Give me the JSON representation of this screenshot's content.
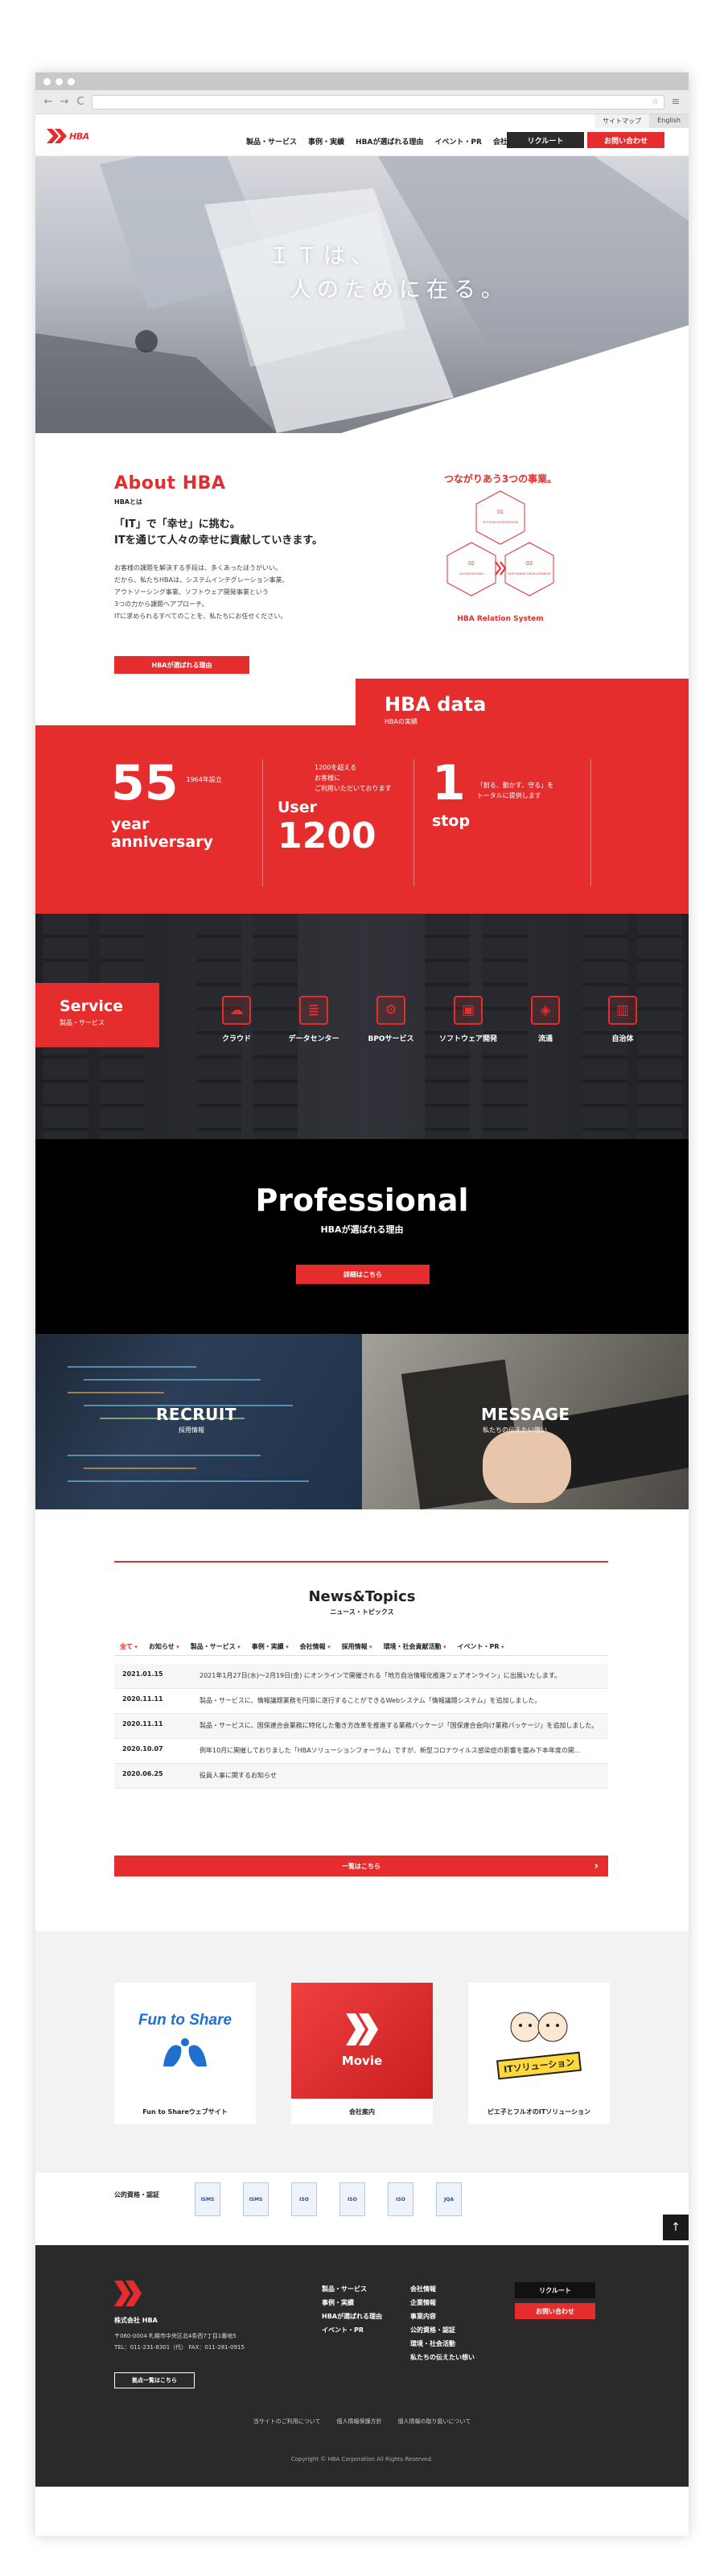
{
  "browser": {
    "nav_back": "←",
    "nav_forward": "→",
    "nav_reload": "C",
    "star": "☆",
    "menu": "≡"
  },
  "header": {
    "utility": [
      "サイトマップ",
      "English"
    ],
    "logo_text": "HBA",
    "nav": [
      "製品・サービス",
      "事例・実績",
      "HBAが選ばれる理由",
      "イベント・PR",
      "会社情報"
    ],
    "recruit_label": "リクルート",
    "contact_label": "お問い合わせ"
  },
  "hero": {
    "line1": "ＩＴは、",
    "line2": "人のために在る。"
  },
  "about": {
    "title": "About HBA",
    "subtitle": "HBAとは",
    "lead1": "「IT」で「幸せ」に挑む。",
    "lead2": "ITを通じて人々の幸せに貢献していきます。",
    "body": [
      "お客様の課題を解決する手段は、多くあったほうがいい。",
      "だから、私たちHBAは、システムインテグレーション事業、",
      "アウトソーシング事業、ソフトウェア開発事業という",
      "3つの力から課題へアプローチ。",
      "ITに求められるすべてのことを、私たちにお任せください。"
    ],
    "button_label": "HBAが選ばれる理由",
    "relation_title": "つながりあう3つの事業。",
    "nodes": [
      {
        "num": "01",
        "label": "SYSTEM INTEGRATION"
      },
      {
        "num": "02",
        "label": "OUTSOURCING"
      },
      {
        "num": "03",
        "label": "SOFTWARE DEVELOPMENT"
      }
    ],
    "relation_label": "HBA Relation System"
  },
  "data_section": {
    "title": "HBA data",
    "subtitle": "HBAの実績",
    "stat1": {
      "number": "55",
      "note": "1964年設立",
      "unit1": "year",
      "unit2": "anniversary"
    },
    "stat2": {
      "note1": "1200を超える",
      "note2": "お客様に",
      "note3": "ご利用いただいております",
      "unit": "User",
      "number": "1200"
    },
    "stat3": {
      "number": "1",
      "note1": "「創る、動かす、守る」を",
      "note2": "トータルに提供します",
      "unit": "stop"
    }
  },
  "service": {
    "title": "Service",
    "subtitle": "製品・サービス",
    "items": [
      {
        "label": "クラウド",
        "icon": "cloud-icon",
        "glyph": "☁"
      },
      {
        "label": "データセンター",
        "icon": "database-icon",
        "glyph": "≣"
      },
      {
        "label": "BPOサービス",
        "icon": "bpo-icon",
        "glyph": "⚙"
      },
      {
        "label": "ソフトウェア開発",
        "icon": "software-icon",
        "glyph": "▣"
      },
      {
        "label": "流通",
        "icon": "box-icon",
        "glyph": "◈"
      },
      {
        "label": "自治体",
        "icon": "building-icon",
        "glyph": "▥"
      }
    ]
  },
  "professional": {
    "title": "Professional",
    "subtitle": "HBAが選ばれる理由",
    "button_label": "詳細はこちら"
  },
  "recruit": {
    "title": "RECRUIT",
    "subtitle": "採用情報"
  },
  "message": {
    "title": "MESSAGE",
    "subtitle": "私たちの伝えたい想い"
  },
  "news": {
    "title": "News&Topics",
    "subtitle": "ニュース・トピックス",
    "tabs": [
      "全て",
      "お知らせ",
      "製品・サービス",
      "事例・実績",
      "会社情報",
      "採用情報",
      "環境・社会貢献活動",
      "イベント・PR"
    ],
    "items": [
      {
        "date": "2021.01.15",
        "text": "2021年1月27日(水)〜2月19日(金) にオンラインで開催される「地方自治情報化推進フェアオンライン」に出展いたします。"
      },
      {
        "date": "2020.11.11",
        "text": "製品・サービスに、情報議題業務を円滑に遂行することができるWebシステム「情報議題システム」を追加しました。"
      },
      {
        "date": "2020.11.11",
        "text": "製品・サービスに、国保連合会業務に特化した働き方改革を推進する業務パッケージ「国保連合会向け業務パッケージ」を追加しました。"
      },
      {
        "date": "2020.10.07",
        "text": "例年10月に開催しておりました「HBAソリューションフォーラム」ですが、新型コロナウイルス感染症の影響を鑑み下本年度の開..."
      },
      {
        "date": "2020.06.25",
        "text": "役員人事に関するお知らせ"
      }
    ],
    "more_label": "一覧はこちら"
  },
  "banners": [
    {
      "caption": "Fun to Shareウェブサイト",
      "art": "Fun to Share"
    },
    {
      "caption": "会社案内",
      "art": "Movie"
    },
    {
      "caption": "ピエ子とフルオのITソリューション",
      "art": "ITソリューション"
    }
  ],
  "certs": {
    "label": "公的資格・認証",
    "items": [
      "ISMS",
      "ISMS",
      "ISO",
      "ISO",
      "ISO",
      "JQA"
    ]
  },
  "pagetop": "↑",
  "footer": {
    "company": "株式会社 HBA",
    "address": "〒060-0004 札幌市中央区北4条西7丁目1番地5",
    "tel": "TEL：011-231-8301（代）  FAX：011-281-0915",
    "base_label": "拠点一覧はこちら",
    "col1": [
      "製品・サービス",
      "事例・実績",
      "HBAが選ばれる理由",
      "イベント・PR"
    ],
    "col2": [
      "会社情報",
      "企業情報",
      "事業内容",
      "公的資格・認証",
      "環境・社会活動",
      "私たちの伝えたい想い"
    ],
    "recruit_label": "リクルート",
    "contact_label": "お問い合わせ",
    "legal": [
      "当サイトのご利用について",
      "個人情報保護方針",
      "個人情報の取り扱いについて"
    ],
    "copyright": "Copyright © HBA Corporation All Rights Reserved."
  },
  "colors": {
    "accent": "#e52d2d",
    "dark": "#2a2a2a"
  }
}
